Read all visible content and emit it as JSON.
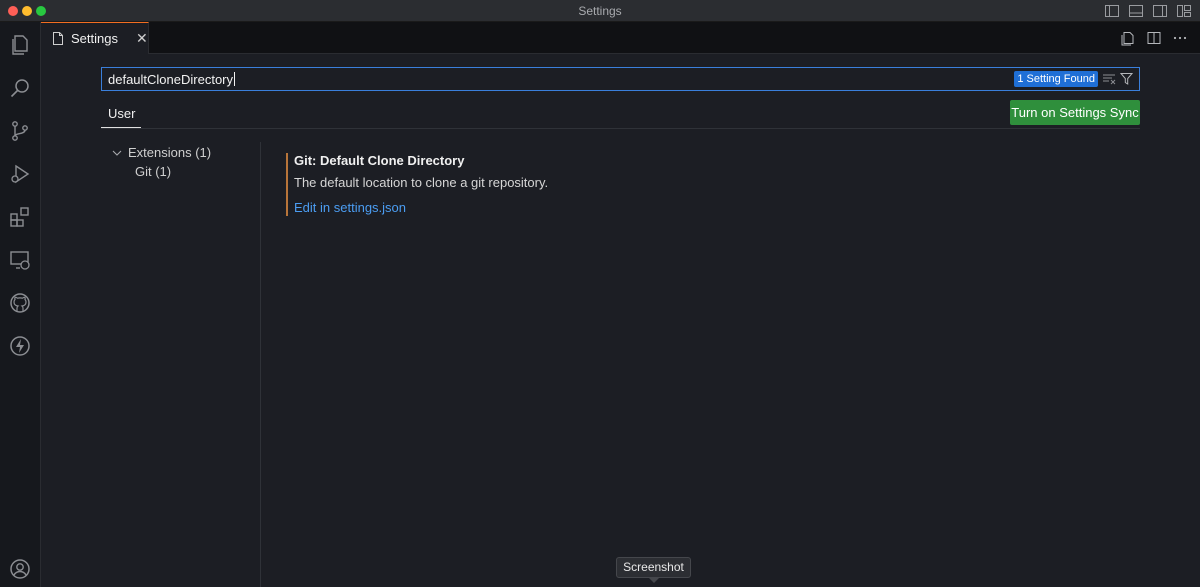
{
  "window": {
    "title": "Settings"
  },
  "tab": {
    "label": "Settings",
    "close_glyph": "✕"
  },
  "search": {
    "value": "defaultCloneDirectory",
    "result_badge": "1 Setting Found"
  },
  "scope": {
    "user_tab": "User"
  },
  "sync_button": {
    "label": "Turn on Settings Sync"
  },
  "toc": {
    "group_label": "Extensions (1)",
    "item_label": "Git (1)"
  },
  "setting": {
    "title": "Git: Default Clone Directory",
    "description": "The default location to clone a git repository.",
    "edit_link": "Edit in settings.json"
  },
  "tooltip": {
    "text": "Screenshot"
  },
  "icons": {
    "activity_bar": [
      "explorer-icon",
      "search-icon",
      "source-control-icon",
      "run-debug-icon",
      "extensions-icon",
      "remote-explorer-icon",
      "github-icon",
      "thunder-icon",
      "account-icon"
    ],
    "title_bar": [
      "toggle-primary-sidebar-icon",
      "toggle-panel-icon",
      "toggle-secondary-sidebar-icon",
      "customize-layout-icon"
    ],
    "editor_actions": [
      "open-settings-json-icon",
      "split-editor-icon",
      "more-actions-icon"
    ]
  },
  "colors": {
    "accent_blue": "#1f6fd6",
    "sync_green": "#2f8f3c",
    "link_blue": "#4b9df2",
    "modified_indicator": "#b8753a",
    "active_tab_border": "#f26d21"
  }
}
